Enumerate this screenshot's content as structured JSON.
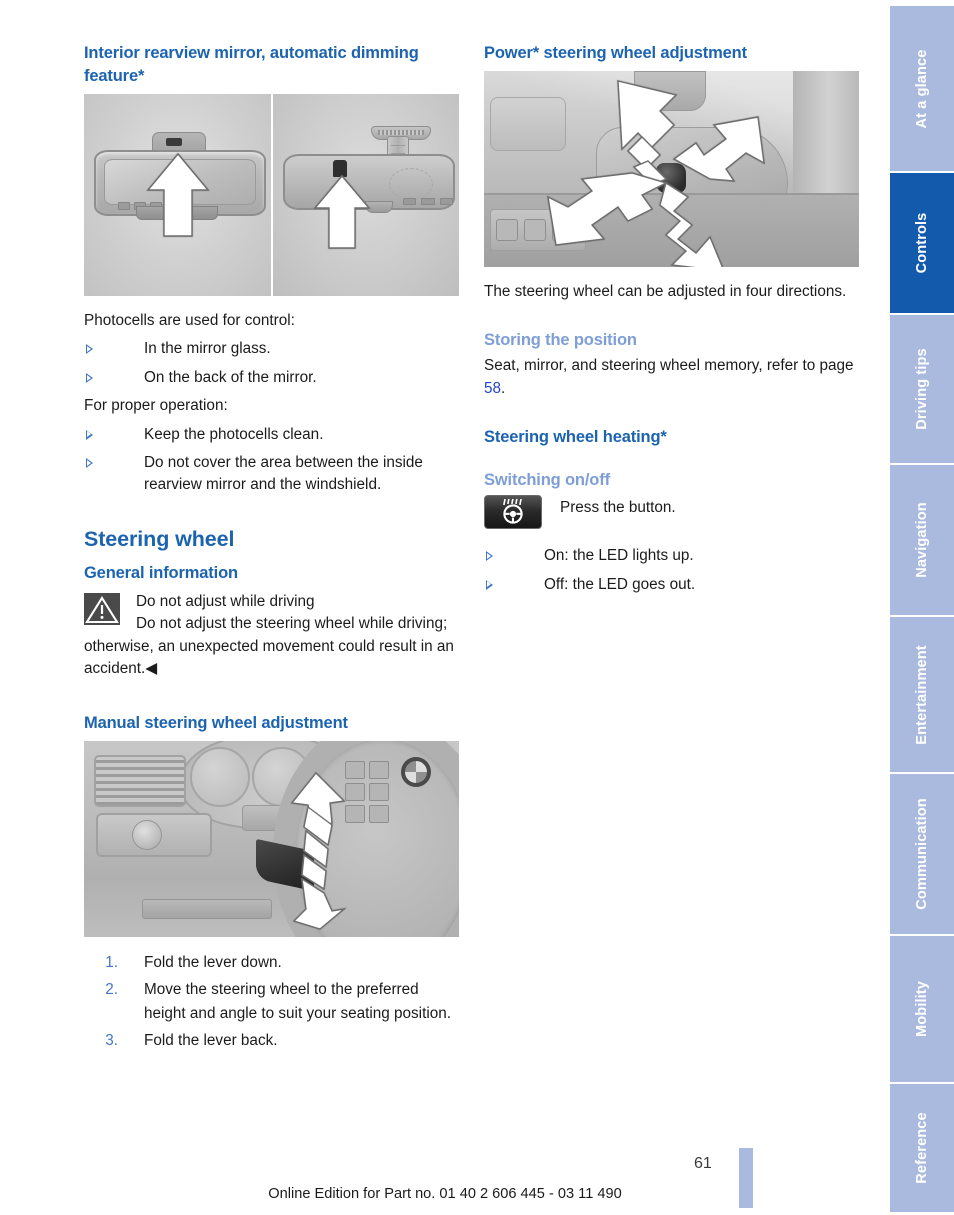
{
  "document": {
    "page_number": "61",
    "footer_note": "Online Edition for Part no. 01 40 2 606 445 - 03 11 490"
  },
  "colors": {
    "heading_blue": "#1c63b0",
    "subheading_blue": "#7e9ed7",
    "tab_inactive": "#aabade",
    "tab_active": "#1359ac",
    "link_blue": "#2244cc",
    "bullet_blue": "#4277c4"
  },
  "left_column": {
    "heading": "Interior rearview mirror, automatic dimming feature*",
    "figure_mirror": {
      "caption": "",
      "alt": "Two views of interior rearview mirror with arrows indicating photocell locations"
    },
    "intro_1": "Photocells are used for control:",
    "bullets_1": [
      "In the mirror glass.",
      "On the back of the mirror."
    ],
    "intro_2": "For proper operation:",
    "bullets_2": [
      "Keep the photocells clean.",
      "Do not cover the area between the inside rearview mirror and the windshield."
    ],
    "chapter_title": "Steering wheel",
    "general_info_heading": "General information",
    "warning": {
      "title": "Do not adjust while driving",
      "body": "Do not adjust the steering wheel while driving; otherwise, an unexpected movement could result in an accident.",
      "end_marker": "◀"
    },
    "manual_heading": "Manual steering wheel adjustment",
    "figure_manual": {
      "alt": "Driver dashboard view with curved arrow showing steering column lever movement"
    },
    "steps": [
      {
        "num": "1.",
        "text": "Fold the lever down."
      },
      {
        "num": "2.",
        "text": "Move the steering wheel to the preferred height and angle to suit your seating position."
      },
      {
        "num": "3.",
        "text": "Fold the lever back."
      }
    ]
  },
  "right_column": {
    "power_heading": "Power* steering wheel adjustment",
    "figure_power": {
      "alt": "Steering column switch with four white arrows showing adjustment directions"
    },
    "power_body": "The steering wheel can be adjusted in four directions.",
    "storing_heading": "Storing the position",
    "storing_body_before": "Seat, mirror, and steering wheel memory, refer to page ",
    "storing_page_ref": "58",
    "storing_body_after": ".",
    "heating_heading": "Steering wheel heating*",
    "switching_heading": "Switching on/off",
    "button_caption": "Press the button.",
    "button_icon_name": "steering-wheel-heating-icon",
    "heating_bullets": [
      "On: the LED lights up.",
      "Off: the LED goes out."
    ]
  },
  "sidebar": {
    "tabs": [
      {
        "label": "At a glance",
        "active": false
      },
      {
        "label": "Controls",
        "active": true
      },
      {
        "label": "Driving tips",
        "active": false
      },
      {
        "label": "Navigation",
        "active": false
      },
      {
        "label": "Entertainment",
        "active": false
      },
      {
        "label": "Communication",
        "active": false
      },
      {
        "label": "Mobility",
        "active": false
      },
      {
        "label": "Reference",
        "active": false
      }
    ]
  }
}
